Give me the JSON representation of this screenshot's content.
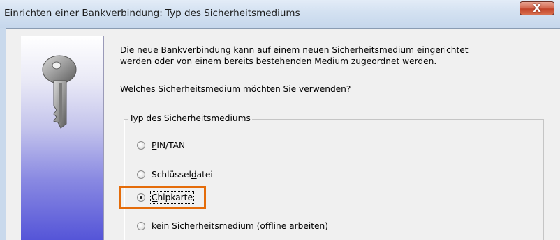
{
  "window": {
    "title": "Einrichten einer Bankverbindung: Typ des Sicherheitsmediums",
    "close_label": "X"
  },
  "content": {
    "description_line1": "Die neue Bankverbindung kann  auf einem neuen Sicherheitsmedium eingerichtet",
    "description_line2": "werden oder von einem bereits bestehenden Medium zugeordnet werden.",
    "question": "Welches Sicherheitsmedium möchten Sie verwenden?"
  },
  "group": {
    "legend": "Typ des Sicherheitsmediums",
    "options": [
      {
        "pre": "",
        "ul": "P",
        "post": "IN/TAN",
        "checked": false
      },
      {
        "pre": "Schlüssel",
        "ul": "d",
        "post": "atei",
        "checked": false
      },
      {
        "pre": "",
        "ul": "C",
        "post": "hipkarte",
        "checked": true
      },
      {
        "pre": "kein Sicherheitsmedium (offline arbeiten)",
        "ul": "",
        "post": "",
        "checked": false
      }
    ]
  },
  "colors": {
    "highlight": "#e46c0a",
    "close_button": "#c2442a"
  },
  "icons": {
    "side": "key-icon",
    "close": "close-icon"
  }
}
